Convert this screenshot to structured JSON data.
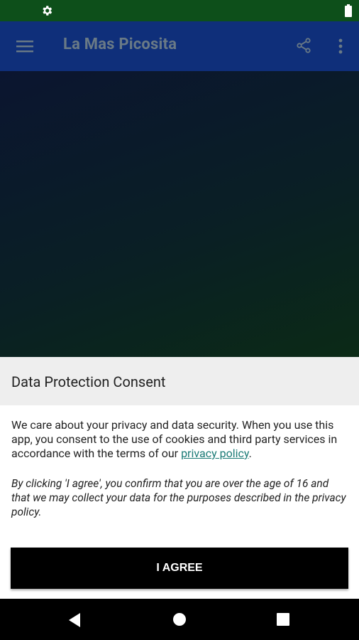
{
  "status_bar": {
    "icons": [
      "gear-icon",
      "battery-icon"
    ]
  },
  "app_bar": {
    "title": "La Mas Picosita",
    "icons": [
      "menu-icon",
      "share-icon",
      "more-vert-icon"
    ]
  },
  "dialog": {
    "title": "Data Protection Consent",
    "body_text": "We care about your privacy and data security. When you use this app, you consent to the use of cookies and third party services in accordance with the terms of our ",
    "privacy_link": "privacy policy",
    "body_suffix": ".",
    "note": "By clicking 'I agree', you confirm that you are over the age of 16 and that we may collect your data for the purposes described in the privacy policy.",
    "agree_button": "I AGREE"
  },
  "nav_bar": {
    "icons": [
      "back-icon",
      "home-icon",
      "recents-icon"
    ]
  },
  "colors": {
    "status_bar": "#0d4f1a",
    "app_bar": "#0f2f7a",
    "link": "#1a7a75",
    "button": "#000000"
  }
}
